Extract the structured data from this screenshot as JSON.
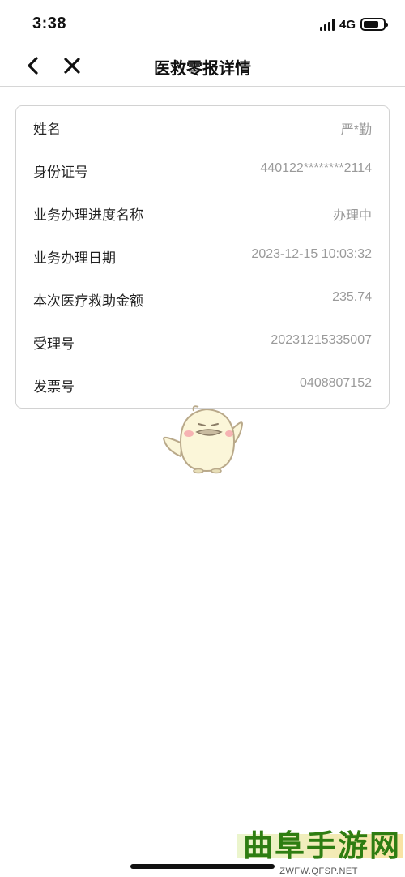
{
  "status_bar": {
    "time": "3:38",
    "network": "4G",
    "battery_level": 0.78
  },
  "nav": {
    "title": "医救零报详情",
    "back_icon": "chevron-left-icon",
    "close_icon": "close-icon"
  },
  "details": [
    {
      "label": "姓名",
      "value": "严*勤"
    },
    {
      "label": "身份证号",
      "value": "440122********2114"
    },
    {
      "label": "业务办理进度名称",
      "value": "办理中"
    },
    {
      "label": "业务办理日期",
      "value": "2023-12-15 10:03:32"
    },
    {
      "label": "本次医疗救助金额",
      "value": "235.74"
    },
    {
      "label": "受理号",
      "value": "20231215335007"
    },
    {
      "label": "发票号",
      "value": "0408807152"
    }
  ],
  "mascot_icon": "mascot-bird-icon",
  "watermark": {
    "main": "曲阜手游网",
    "sub": "ZWFW.QFSP.NET"
  },
  "colors": {
    "label": "#222222",
    "value": "#9a9a9a",
    "border": "#d2d2d2",
    "watermark_green": "#2e7d12"
  }
}
